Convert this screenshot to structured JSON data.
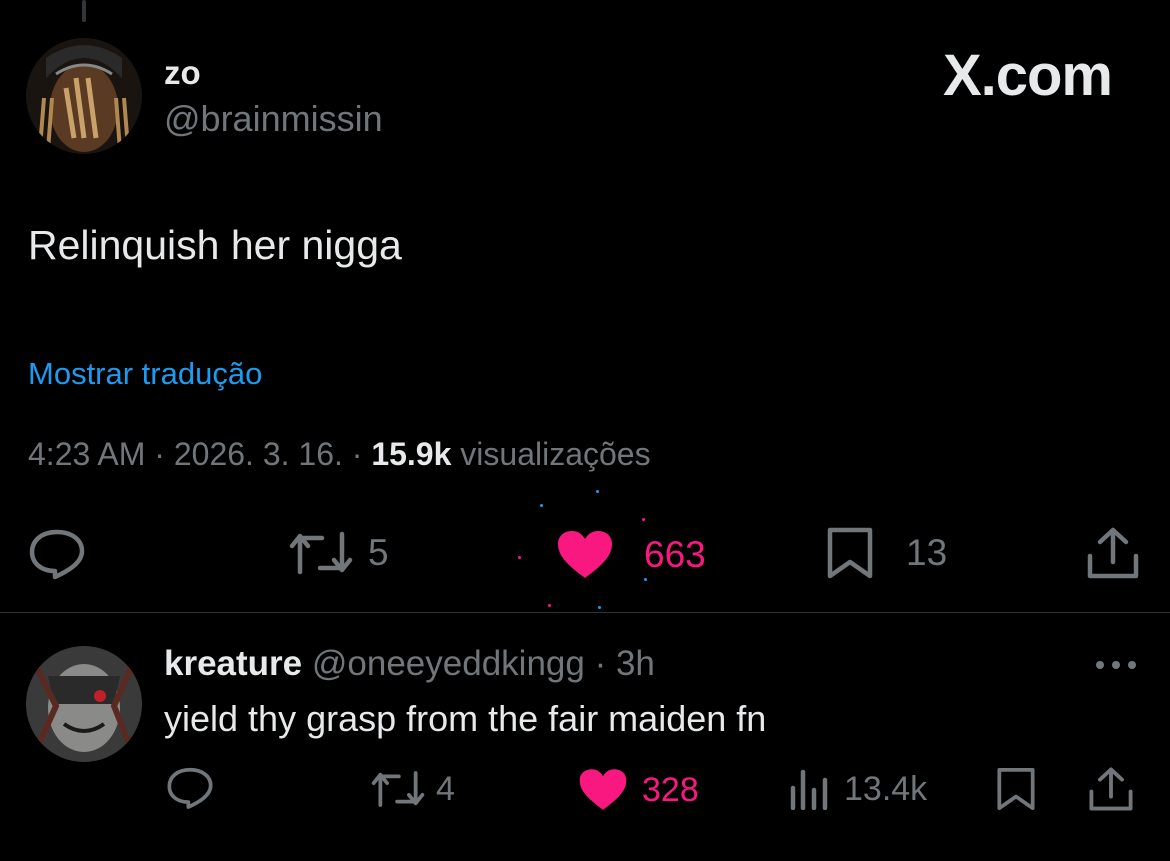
{
  "brand": "X.com",
  "tweet": {
    "author_name": "zo",
    "author_handle": "@brainmissin",
    "text": "Relinquish her nigga",
    "translate_link": "Mostrar tradução",
    "time": "4:23 AM",
    "date": "2026. 3. 16.",
    "views_count": "15.9k",
    "views_label": "visualizações",
    "retweets": "5",
    "likes": "663",
    "bookmarks": "13"
  },
  "reply": {
    "author_name": "kreature",
    "author_handle": "@oneeyeddkingg",
    "time": "3h",
    "text": "yield thy grasp from the fair maiden fn",
    "retweets": "4",
    "likes": "328",
    "views": "13.4k"
  },
  "colors": {
    "background": "#000000",
    "text": "#e7e9ea",
    "muted": "#71767b",
    "link": "#1d9bf0",
    "like": "#f91880"
  },
  "icons": {
    "reply": "reply-icon",
    "retweet": "retweet-icon",
    "like": "heart-icon",
    "bookmark": "bookmark-icon",
    "share": "share-icon",
    "views": "views-icon",
    "more": "more-icon"
  }
}
